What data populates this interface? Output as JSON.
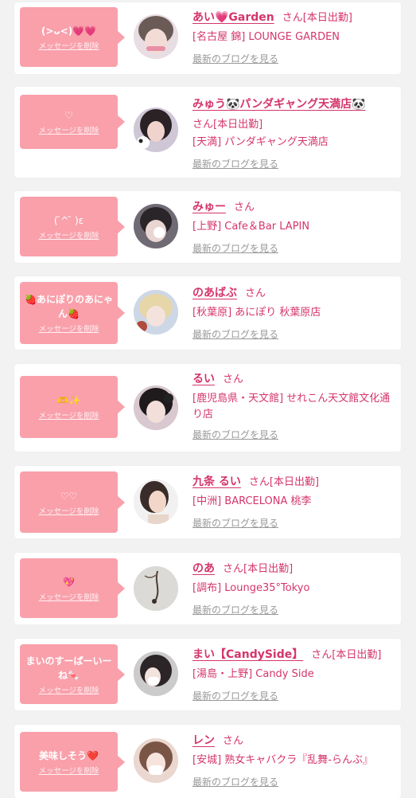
{
  "actions": {
    "delete_message": "メッセージを削除",
    "latest_blog": "最新のブログを見る"
  },
  "colors": {
    "bubble": "#f9a0ab",
    "accent": "#d5356b",
    "muted": "#999999"
  },
  "entries": [
    {
      "message": "(>ᴗ<)💗💗",
      "name": "あい💗Garden",
      "honorific": "さん",
      "shift": "[本日出勤]",
      "shop": "[名古屋 錦] LOUNGE GARDEN",
      "avatar": "avatar-photo"
    },
    {
      "message": "♡",
      "name": "みゅう🐼パンダギャング天満店🐼",
      "honorific": "さん",
      "shift": "[本日出勤]",
      "shop": "[天満] パンダギャング天満店",
      "avatar": "avatar-photo"
    },
    {
      "message": "( ̄^ ̄ )ε",
      "name": "みゅー",
      "honorific": "さん",
      "shift": "",
      "shop": "[上野] Cafe＆Bar LAPIN",
      "avatar": "avatar-photo"
    },
    {
      "message": "🍓あにぽりのあにゃん🍓",
      "name": "のあばぶ",
      "honorific": "さん",
      "shift": "",
      "shop": "[秋葉原] あにぽり 秋葉原店",
      "avatar": "avatar-photo"
    },
    {
      "message": "🫶✨",
      "name": "るい",
      "honorific": "さん",
      "shift": "",
      "shop": "[鹿児島県・天文館] せれこん天文館文化通り店",
      "avatar": "avatar-photo"
    },
    {
      "message": "♡♡",
      "name": "九条 るい",
      "honorific": "さん",
      "shift": "[本日出勤]",
      "shop": "[中洲] BARCELONA 桃李",
      "avatar": "avatar-photo"
    },
    {
      "message": "💖",
      "name": "のあ",
      "honorific": "さん",
      "shift": "[本日出勤]",
      "shop": "[調布] Lounge35°Tokyo",
      "avatar": "avatar-photo"
    },
    {
      "message": "まいのすーぱーいーね🍬",
      "name": "まい【CandySide】",
      "honorific": "さん",
      "shift": "[本日出勤]",
      "shop": "[湯島・上野] Candy Side",
      "avatar": "avatar-photo"
    },
    {
      "message": "美味しそう❤️",
      "name": "レン",
      "honorific": "さん",
      "shift": "",
      "shop": "[安城] 熟女キャバクラ『乱舞-らんぶ』",
      "avatar": "avatar-photo"
    }
  ]
}
